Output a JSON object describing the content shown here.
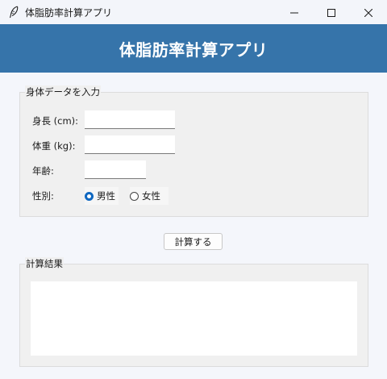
{
  "window": {
    "title": "体脂肪率計算アプリ",
    "icon": "feather-icon",
    "controls": [
      "minimize-icon",
      "maximize-icon",
      "close-icon"
    ]
  },
  "header": {
    "title": "体脂肪率計算アプリ",
    "background": "#3674aa"
  },
  "input_group": {
    "legend": "身体データを入力",
    "height_label": "身長 (cm):",
    "height_value": "",
    "weight_label": "体重 (kg):",
    "weight_value": "",
    "age_label": "年齢:",
    "age_value": "",
    "gender_label": "性別:",
    "gender_options": [
      {
        "label": "男性",
        "checked": true
      },
      {
        "label": "女性",
        "checked": false
      }
    ]
  },
  "calculate_button": {
    "label": "計算する"
  },
  "result_group": {
    "legend": "計算結果",
    "text": ""
  },
  "colors": {
    "accent": "#0f67c0",
    "header": "#3674aa",
    "background": "#f4f6fb"
  }
}
